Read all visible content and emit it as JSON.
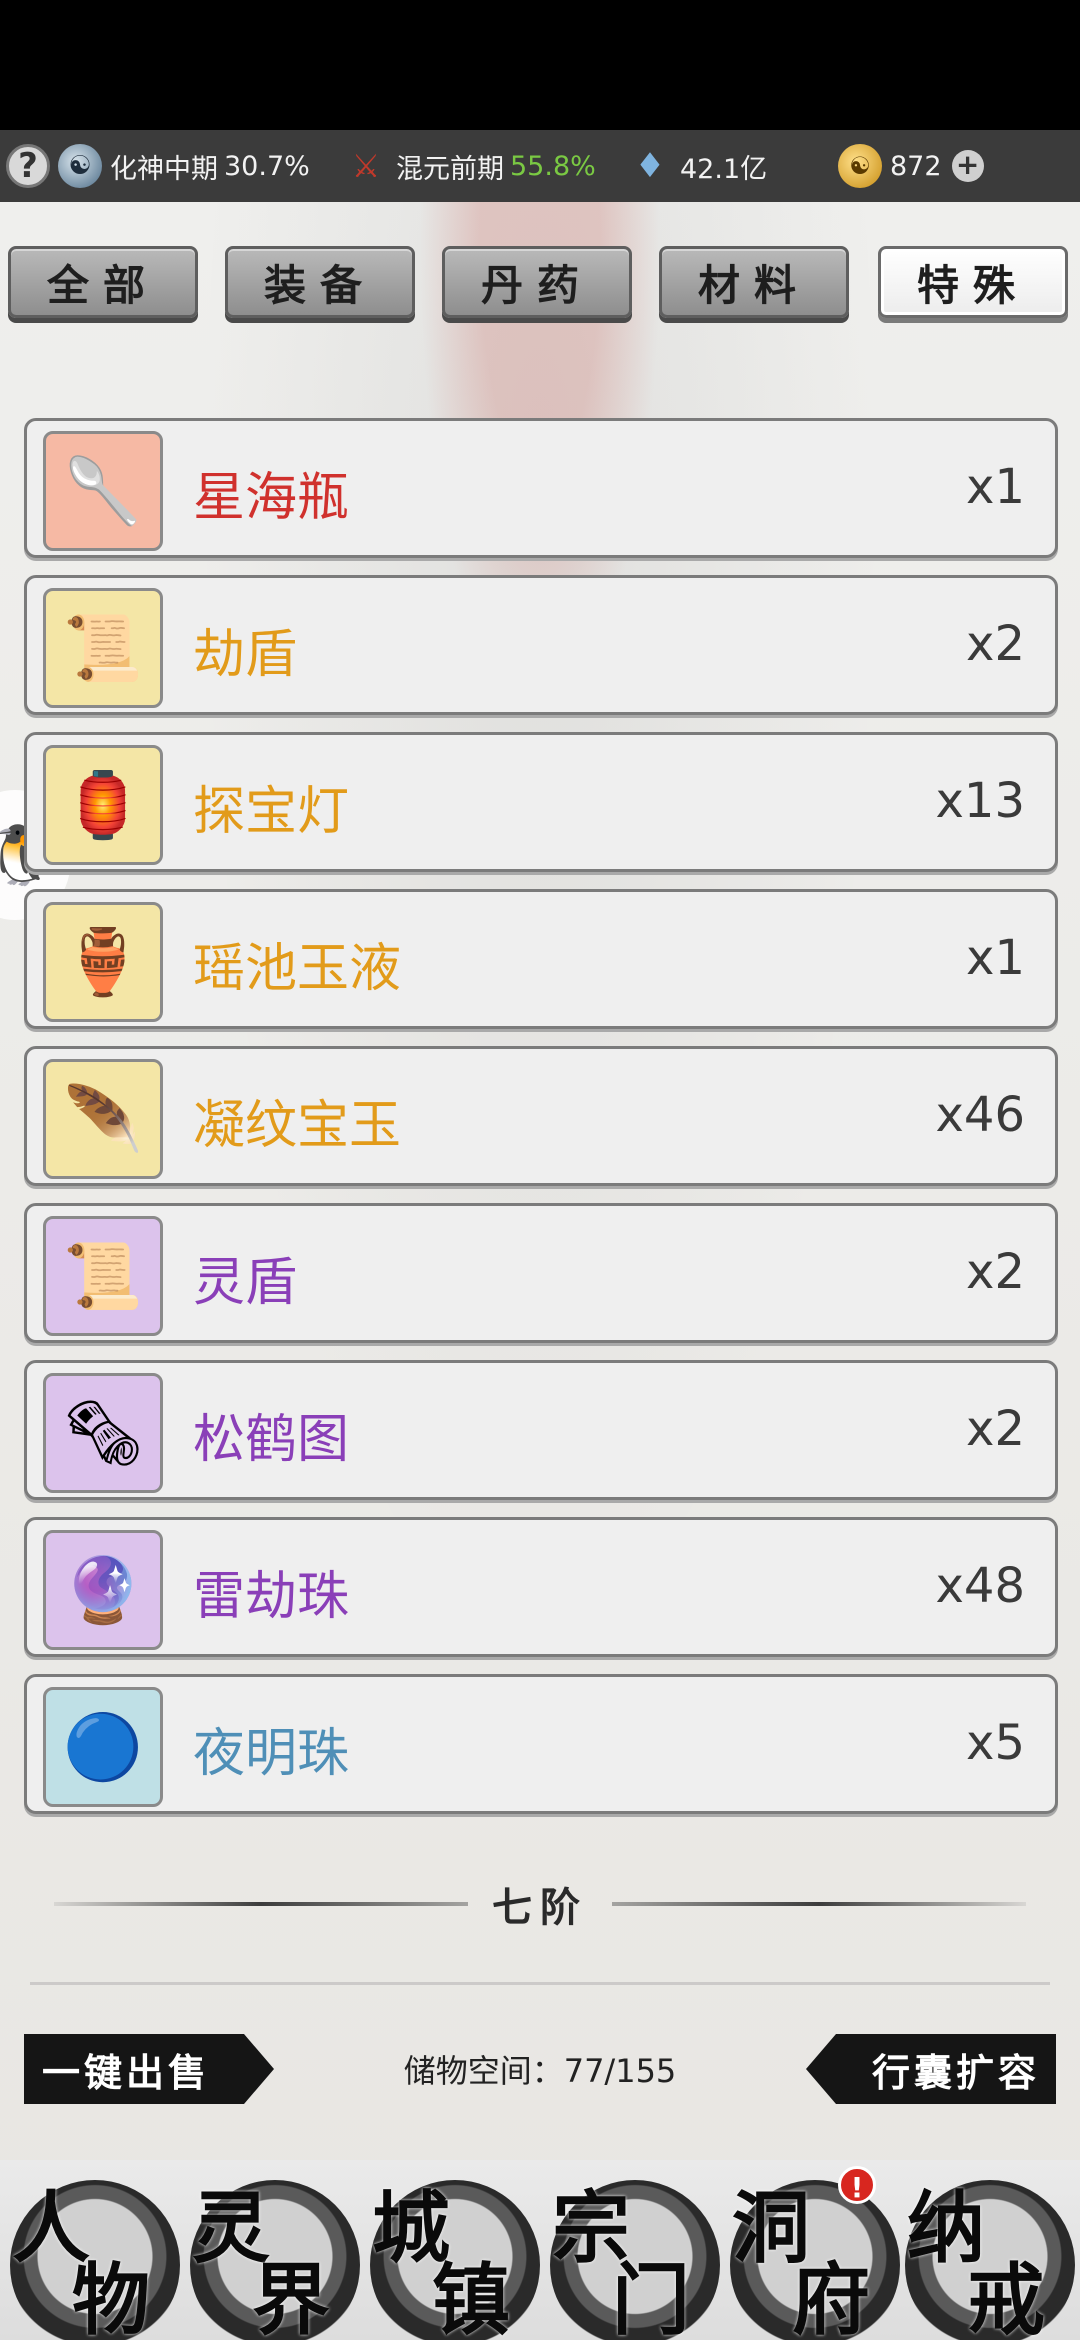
{
  "status_bar": {
    "help_icon": "?",
    "realm": {
      "icon": "yin-orb-icon",
      "label": "化神中期",
      "percent": "30.7%"
    },
    "tier": {
      "icon": "sword-icon",
      "label": "混元前期",
      "percent": "55.8%",
      "percent_color": "#7ac943"
    },
    "crystals": {
      "icon": "crystal-icon",
      "value": "42.1亿"
    },
    "coins": {
      "icon": "coin-icon",
      "value": "872"
    },
    "plus": "+"
  },
  "tabs": [
    {
      "label": "全部",
      "active": false
    },
    {
      "label": "装备",
      "active": false
    },
    {
      "label": "丹药",
      "active": false
    },
    {
      "label": "材料",
      "active": false
    },
    {
      "label": "特殊",
      "active": true
    }
  ],
  "items": [
    {
      "name": "星海瓶",
      "qty": "x1",
      "color": "#d0312d",
      "bg": "#f6b9a4",
      "icon": "🥄"
    },
    {
      "name": "劫盾",
      "qty": "x2",
      "color": "#e29b1a",
      "bg": "#f4e6a6",
      "icon": "📜"
    },
    {
      "name": "探宝灯",
      "qty": "x13",
      "color": "#e29b1a",
      "bg": "#f4e6a6",
      "icon": "🏮"
    },
    {
      "name": "瑶池玉液",
      "qty": "x1",
      "color": "#e29b1a",
      "bg": "#f4e6a6",
      "icon": "🏺"
    },
    {
      "name": "凝纹宝玉",
      "qty": "x46",
      "color": "#e29b1a",
      "bg": "#f4e6a6",
      "icon": "🪶"
    },
    {
      "name": "灵盾",
      "qty": "x2",
      "color": "#8a3fb8",
      "bg": "#dcc3ec",
      "icon": "📜"
    },
    {
      "name": "松鹤图",
      "qty": "x2",
      "color": "#8a3fb8",
      "bg": "#dcc3ec",
      "icon": "🗞"
    },
    {
      "name": "雷劫珠",
      "qty": "x48",
      "color": "#8a3fb8",
      "bg": "#dcc3ec",
      "icon": "🔮"
    },
    {
      "name": "夜明珠",
      "qty": "x5",
      "color": "#4f8fb7",
      "bg": "#bfe0e6",
      "icon": "🔵"
    }
  ],
  "tier_label": "七阶",
  "actions": {
    "sell_all": "一键出售",
    "expand": "行囊扩容",
    "storage": "储物空间：77/155"
  },
  "bottom_nav": [
    {
      "c1": "人",
      "c2": "物",
      "alert": false
    },
    {
      "c1": "灵",
      "c2": "界",
      "alert": false
    },
    {
      "c1": "城",
      "c2": "镇",
      "alert": false
    },
    {
      "c1": "宗",
      "c2": "门",
      "alert": false
    },
    {
      "c1": "洞",
      "c2": "府",
      "alert": true,
      "alert_text": "!"
    },
    {
      "c1": "纳",
      "c2": "戒",
      "alert": false
    }
  ],
  "side_bubble_icon": "penguin-icon"
}
